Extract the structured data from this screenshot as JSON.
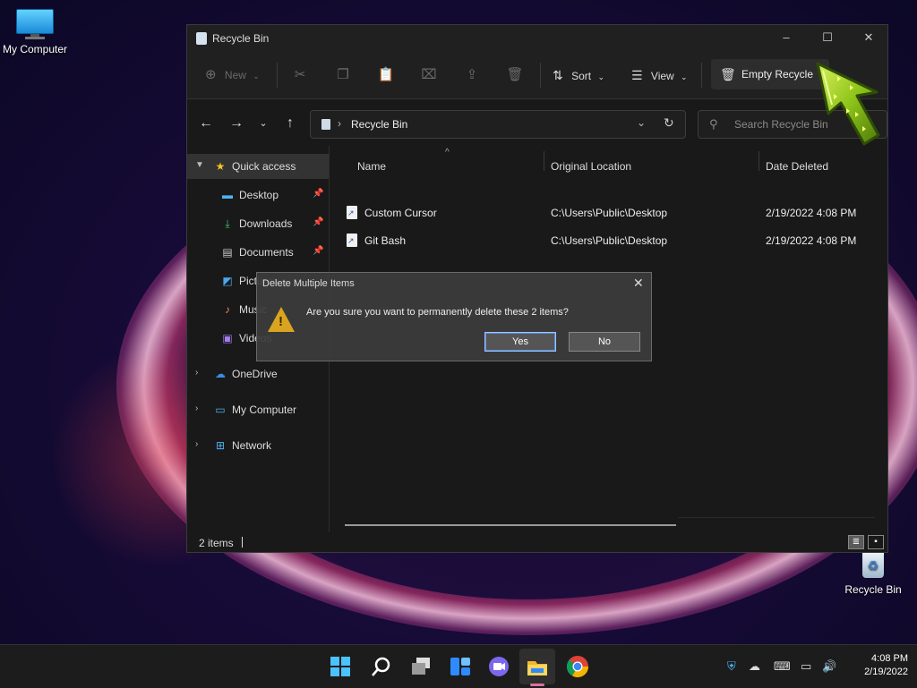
{
  "desktop": {
    "icons": [
      {
        "label": "My Computer"
      },
      {
        "label": "Recycle Bin"
      }
    ]
  },
  "window": {
    "title": "Recycle Bin",
    "commandbar": {
      "new_label": "New",
      "sort_label": "Sort",
      "view_label": "View",
      "empty_label": "Empty Recycle"
    },
    "address": {
      "path": "Recycle Bin",
      "search_placeholder": "Search Recycle Bin"
    },
    "navpane": {
      "items": [
        {
          "label": "Quick access"
        },
        {
          "label": "Desktop"
        },
        {
          "label": "Downloads"
        },
        {
          "label": "Documents"
        },
        {
          "label": "Pictures"
        },
        {
          "label": "Music"
        },
        {
          "label": "Videos"
        },
        {
          "label": "OneDrive"
        },
        {
          "label": "My Computer"
        },
        {
          "label": "Network"
        }
      ]
    },
    "filelist": {
      "columns": [
        "Name",
        "Original Location",
        "Date Deleted"
      ],
      "rows": [
        {
          "name": "Custom Cursor",
          "location": "C:\\Users\\Public\\Desktop",
          "date": "2/19/2022 4:08 PM"
        },
        {
          "name": "Git Bash",
          "location": "C:\\Users\\Public\\Desktop",
          "date": "2/19/2022 4:08 PM"
        }
      ]
    },
    "status": {
      "items": "2 items"
    }
  },
  "dialog": {
    "title": "Delete Multiple Items",
    "message": "Are you sure you want to permanently delete these 2 items?",
    "yes_label": "Yes",
    "no_label": "No"
  },
  "taskbar": {
    "time": "4:08 PM",
    "date": "2/19/2022"
  },
  "colors": {
    "accent": "#e06fa0",
    "warning": "#d9a520",
    "cursor": "#9ad11e"
  }
}
